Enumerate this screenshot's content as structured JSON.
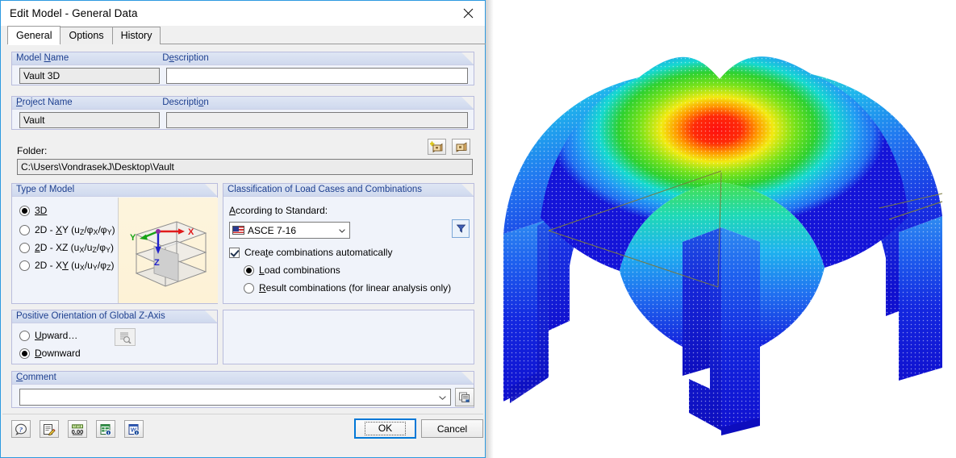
{
  "window": {
    "title": "Edit Model - General Data",
    "close_icon": "close-icon"
  },
  "tabs": [
    {
      "label": "General",
      "active": true
    },
    {
      "label": "Options",
      "active": false
    },
    {
      "label": "History",
      "active": false
    }
  ],
  "general": {
    "model_name": {
      "label": "Model Name",
      "label_accel_index": 6,
      "value": "Vault 3D",
      "placeholder": ""
    },
    "model_description": {
      "label": "Description",
      "value": "",
      "placeholder": ""
    },
    "project_name": {
      "label": "Project Name",
      "value": "Vault",
      "placeholder": ""
    },
    "project_description": {
      "label": "Description",
      "value": "",
      "placeholder": ""
    },
    "project_buttons": [
      {
        "name": "new-project-button",
        "icon": "new-project-icon",
        "tooltip": "New Project"
      },
      {
        "name": "select-project-button",
        "icon": "select-project-icon",
        "tooltip": "Select Project"
      }
    ],
    "folder": {
      "label": "Folder:",
      "value": "C:\\Users\\VondrasekJ\\Desktop\\Vault"
    }
  },
  "type_of_model": {
    "caption": "Type of Model",
    "options": [
      {
        "label": "3D",
        "sub": "",
        "selected": true
      },
      {
        "label": "2D - XY (u",
        "sub": "z/φx/φy)",
        "selected": false
      },
      {
        "label": "2D - XZ (u",
        "sub": "x/uz/φy)",
        "selected": false
      },
      {
        "label": "2D - XY (u",
        "sub": "x/uy/φz)",
        "selected": false
      }
    ],
    "preview": {
      "name": "model-type-preview",
      "axes": [
        {
          "label": "X",
          "color": "#e01b1b"
        },
        {
          "label": "Y",
          "color": "#17a317"
        },
        {
          "label": "Z",
          "color": "#2121c8"
        }
      ]
    }
  },
  "classification": {
    "caption": "Classification of Load Cases and Combinations",
    "standard_label": "According to Standard:",
    "standard_value": "ASCE 7-16",
    "standard_flag": "us-flag-icon",
    "filter_button": {
      "name": "standard-filter-button",
      "icon": "filter-icon"
    },
    "create_combinations": {
      "label": "Create combinations automatically",
      "checked": true
    },
    "combination_type": [
      {
        "label": "Load combinations",
        "selected": true
      },
      {
        "label": "Result combinations (for linear analysis only)",
        "selected": false
      }
    ]
  },
  "z_axis": {
    "caption": "Positive Orientation of Global Z-Axis",
    "options": [
      {
        "label": "Upward…",
        "selected": false
      },
      {
        "label": "Downward",
        "selected": true
      }
    ],
    "preview_button": {
      "name": "z-axis-preview-button",
      "icon": "preview-magnifier-icon",
      "disabled": true
    }
  },
  "comment": {
    "caption": "Comment",
    "value": "",
    "placeholder": "",
    "picker_button": {
      "name": "comment-library-button",
      "icon": "copy-pages-icon"
    }
  },
  "footer": {
    "tools": [
      {
        "name": "help-button",
        "icon": "help-question-icon"
      },
      {
        "name": "notes-button",
        "icon": "edit-note-icon"
      },
      {
        "name": "units-button",
        "icon": "units-ruler-icon"
      },
      {
        "name": "export-excel-button",
        "icon": "excel-export-icon"
      },
      {
        "name": "export-word-button",
        "icon": "word-export-icon"
      }
    ],
    "ok_label": "OK",
    "cancel_label": "Cancel"
  },
  "viewport": {
    "name": "model-3d-viewport",
    "description": "Deformed groin vault FEA mesh with rainbow result colors",
    "colors": {
      "max": "#ff0f0f",
      "high": "#ff9a00",
      "mid_high": "#f2ea12",
      "mid": "#2fd12f",
      "mid_low": "#16d8d0",
      "low": "#1f6df0",
      "min": "#1010cf",
      "outline": "#7a7a40"
    }
  }
}
